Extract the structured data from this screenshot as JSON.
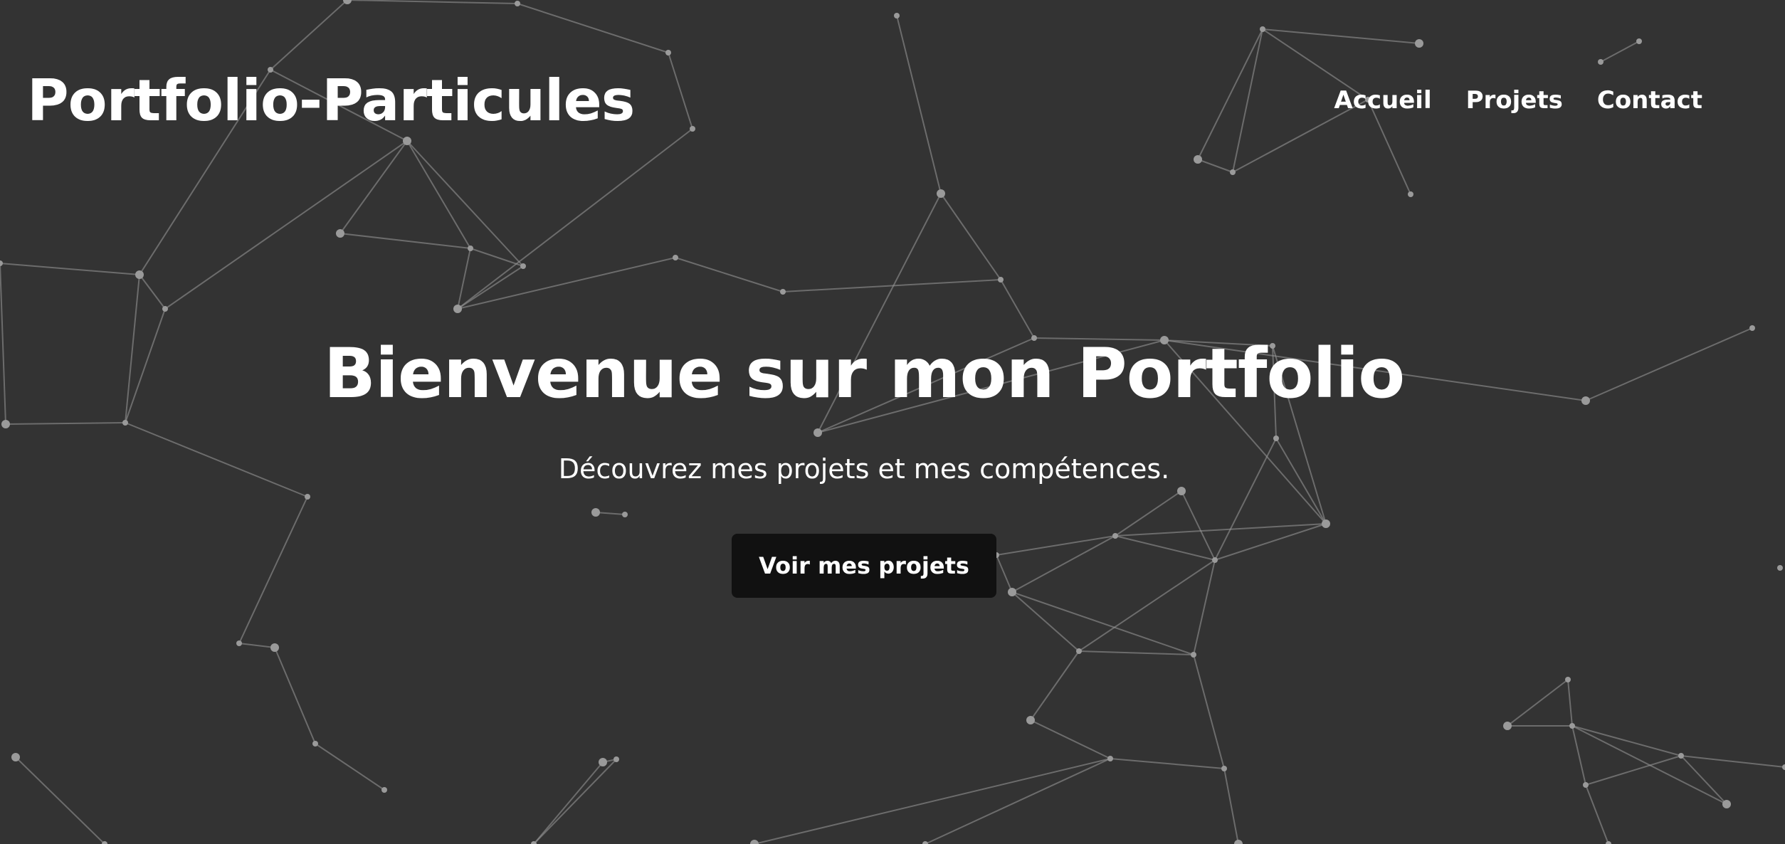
{
  "header": {
    "logo": "Portfolio-Particules",
    "nav": [
      {
        "label": "Accueil"
      },
      {
        "label": "Projets"
      },
      {
        "label": "Contact"
      }
    ]
  },
  "hero": {
    "title": "Bienvenue sur mon Portfolio",
    "subtitle": "Découvrez mes projets et mes compétences.",
    "cta_label": "Voir mes projets"
  },
  "colors": {
    "background": "#333333",
    "button_bg": "#111111",
    "text": "#ffffff",
    "particles": "#9a9a9a"
  }
}
